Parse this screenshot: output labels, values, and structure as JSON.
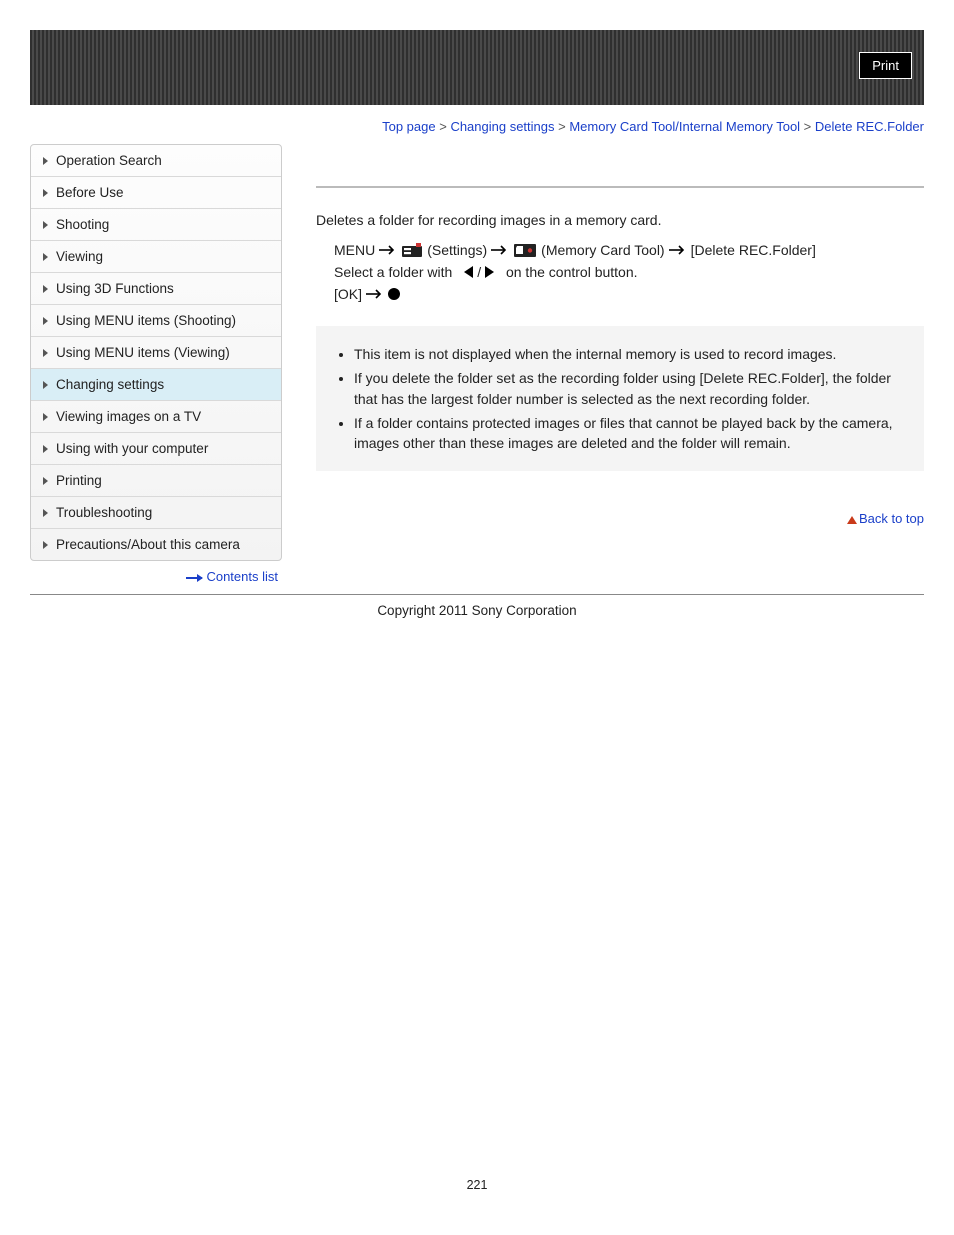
{
  "header": {
    "print_label": "Print"
  },
  "breadcrumb": {
    "items": [
      "Top page",
      "Changing settings",
      "Memory Card Tool/Internal Memory Tool"
    ],
    "current": "Delete REC.Folder",
    "sep": " > "
  },
  "sidebar": {
    "items": [
      {
        "label": "Operation Search",
        "active": false
      },
      {
        "label": "Before Use",
        "active": false
      },
      {
        "label": "Shooting",
        "active": false
      },
      {
        "label": "Viewing",
        "active": false
      },
      {
        "label": "Using 3D Functions",
        "active": false
      },
      {
        "label": "Using MENU items (Shooting)",
        "active": false
      },
      {
        "label": "Using MENU items (Viewing)",
        "active": false
      },
      {
        "label": "Changing settings",
        "active": true
      },
      {
        "label": "Viewing images on a TV",
        "active": false
      },
      {
        "label": "Using with your computer",
        "active": false
      },
      {
        "label": "Printing",
        "active": false
      },
      {
        "label": "Troubleshooting",
        "active": false
      },
      {
        "label": "Precautions/About this camera",
        "active": false
      }
    ],
    "contents_link": "Contents list"
  },
  "content": {
    "intro": "Deletes a folder for recording images in a memory card.",
    "step1": {
      "menu": "MENU",
      "settings": "(Settings)",
      "tool": "(Memory Card Tool)",
      "target": "[Delete REC.Folder]"
    },
    "step2_pre": "Select a folder with",
    "step2_sep": " / ",
    "step2_post": "on the control button.",
    "step3": "[OK]",
    "notes": [
      "This item is not displayed when the internal memory is used to record images.",
      "If you delete the folder set as the recording folder using [Delete REC.Folder], the folder that has the largest folder number is selected as the next recording folder.",
      "If a folder contains protected images or files that cannot be played back by the camera, images other than these images are deleted and the folder will remain."
    ],
    "back_to_top": "Back to top"
  },
  "footer": {
    "copyright": "Copyright 2011 Sony Corporation",
    "page_number": "221"
  }
}
